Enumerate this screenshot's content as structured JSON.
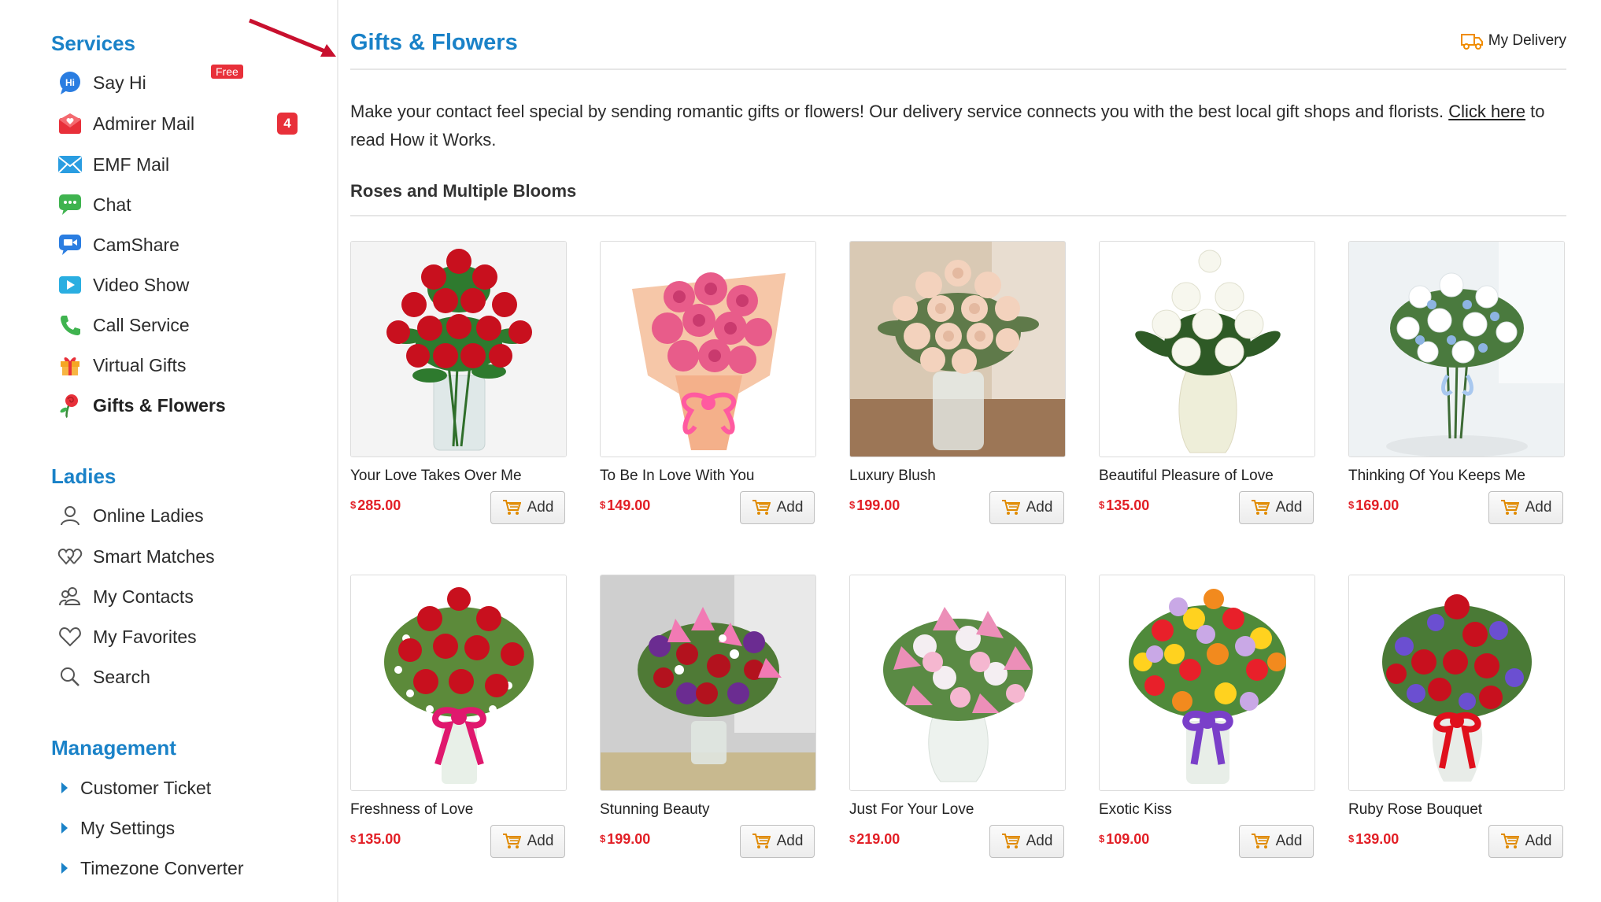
{
  "sidebar": {
    "services_heading": "Services",
    "services": [
      {
        "label": "Say Hi",
        "icon": "say-hi-icon",
        "badge": "Free"
      },
      {
        "label": "Admirer Mail",
        "icon": "admirer-mail-icon",
        "count": "4"
      },
      {
        "label": "EMF Mail",
        "icon": "emf-mail-icon"
      },
      {
        "label": "Chat",
        "icon": "chat-icon"
      },
      {
        "label": "CamShare",
        "icon": "camshare-icon"
      },
      {
        "label": "Video Show",
        "icon": "video-show-icon"
      },
      {
        "label": "Call Service",
        "icon": "phone-icon"
      },
      {
        "label": "Virtual Gifts",
        "icon": "gift-icon"
      },
      {
        "label": "Gifts & Flowers",
        "icon": "rose-icon",
        "active": true
      }
    ],
    "ladies_heading": "Ladies",
    "ladies": [
      {
        "label": "Online Ladies",
        "icon": "user-icon"
      },
      {
        "label": "Smart Matches",
        "icon": "hearts-icon"
      },
      {
        "label": "My Contacts",
        "icon": "contacts-icon"
      },
      {
        "label": "My Favorites",
        "icon": "heart-icon"
      },
      {
        "label": "Search",
        "icon": "search-icon"
      }
    ],
    "management_heading": "Management",
    "management": [
      {
        "label": "Customer Ticket"
      },
      {
        "label": "My Settings"
      },
      {
        "label": "Timezone Converter"
      }
    ]
  },
  "main": {
    "title": "Gifts & Flowers",
    "my_delivery": "My Delivery",
    "intro_text": "Make your contact feel special by sending romantic gifts or flowers! Our delivery service connects you with the best local gift shops and florists.",
    "intro_link": "Click here",
    "intro_tail": "to read How it Works.",
    "section_title": "Roses and Multiple Blooms",
    "add_label": "Add",
    "currency": "$",
    "products": [
      {
        "name": "Your Love Takes Over Me",
        "price": "285.00"
      },
      {
        "name": "To Be In Love With You",
        "price": "149.00"
      },
      {
        "name": "Luxury Blush",
        "price": "199.00"
      },
      {
        "name": "Beautiful Pleasure of Love",
        "price": "135.00"
      },
      {
        "name": "Thinking Of You Keeps Me",
        "price": "169.00"
      },
      {
        "name": "Freshness of Love",
        "price": "135.00"
      },
      {
        "name": "Stunning Beauty",
        "price": "199.00"
      },
      {
        "name": "Just For Your Love",
        "price": "219.00"
      },
      {
        "name": "Exotic Kiss",
        "price": "109.00"
      },
      {
        "name": "Ruby Rose Bouquet",
        "price": "139.00"
      }
    ]
  },
  "colors": {
    "accent": "#1a82c8",
    "price": "#e21f26",
    "badge": "#e8303a",
    "arrow": "#c8102e"
  }
}
